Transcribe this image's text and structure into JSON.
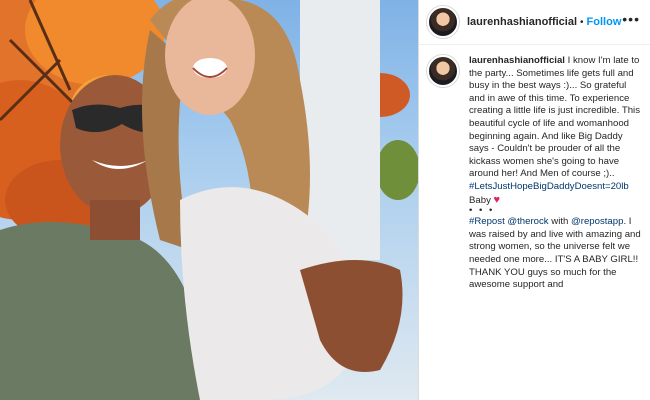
{
  "post": {
    "username": "laurenhashianofficial",
    "separator": "•",
    "follow_label": "Follow",
    "more_icon": "more-options-icon"
  },
  "caption": {
    "username": "laurenhashianofficial",
    "text_1": "I know I'm late to the party... Sometimes life gets full and busy in the best ways :)... So grateful and in awe of this time. To experience creating a little life is just incredible. This beautiful cycle of life and womanhood beginning again. And like Big Daddy says - Couldn't be prouder of all the kickass women she's going to have around her! And Men of course ;)..",
    "hashtag": "#LetsJustHopeBigDaddyDoesnt=20lb",
    "text_2": "Baby",
    "heart": "♥",
    "dots": "• • •",
    "repost_tag": "#Repost",
    "mention_1": "@therock",
    "text_3": "with",
    "mention_2": "@repostapp",
    "text_4": ".",
    "text_5": "I was raised by and live with amazing and strong women, so the universe felt we needed one more... IT'S A BABY GIRL!! THANK YOU guys so much for the awesome support and"
  },
  "colors": {
    "link": "#00376b",
    "follow": "#0095f6",
    "heart": "#e0245e"
  }
}
